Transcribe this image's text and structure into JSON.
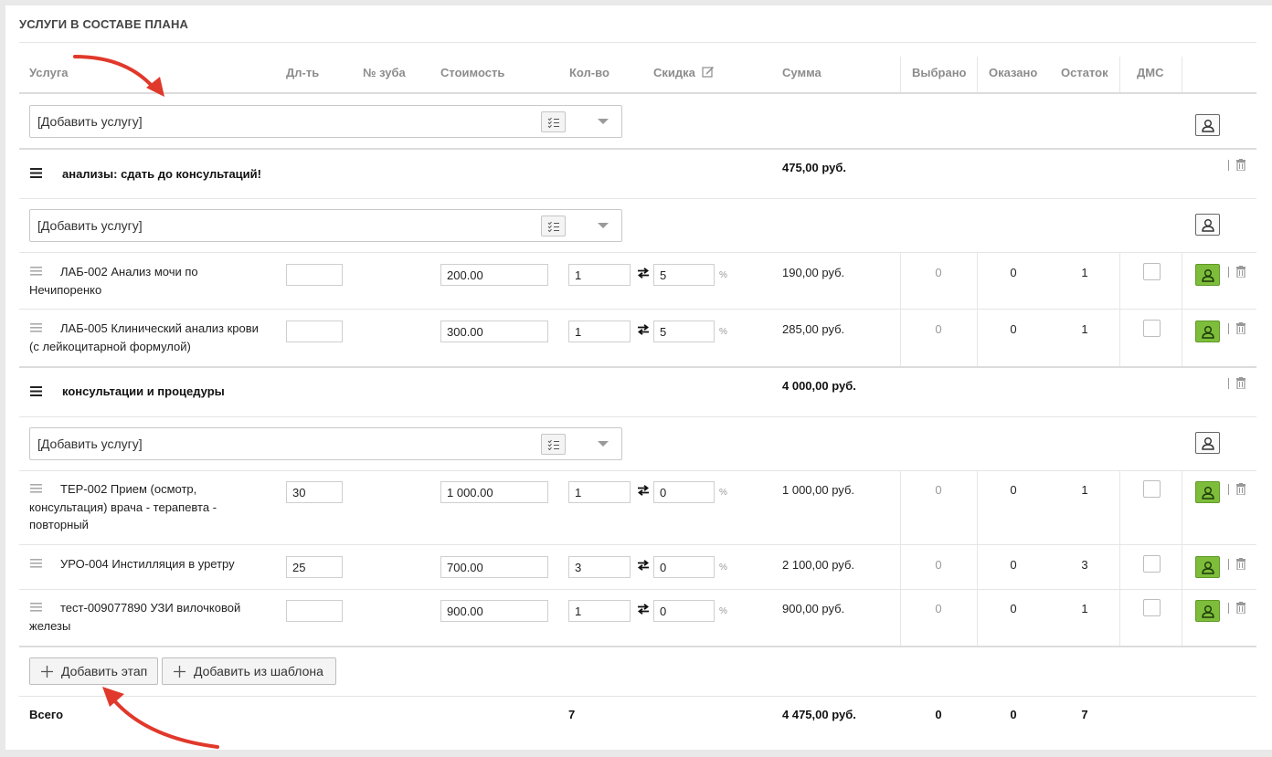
{
  "section": {
    "title": "УСЛУГИ В СОСТАВЕ ПЛАНА"
  },
  "columns": {
    "service": "Услуга",
    "duration": "Дл-ть",
    "tooth": "№ зуба",
    "price": "Стоимость",
    "qty": "Кол-во",
    "discount": "Скидка",
    "sum": "Сумма",
    "selected": "Выбрано",
    "done": "Оказано",
    "rest": "Остаток",
    "dms": "ДМС"
  },
  "add_service_placeholder": "[Добавить услугу]",
  "percent_sign": "%",
  "groups": [
    {
      "title": "анализы: сдать до консультаций!",
      "sum": "475,00 руб.",
      "items": [
        {
          "name": "ЛАБ-002 Анализ мочи по Нечипоренко",
          "duration": "",
          "price": "200.00",
          "qty": "1",
          "discount": "5",
          "sum": "190,00 руб.",
          "selected": "0",
          "done": "0",
          "rest": "1"
        },
        {
          "name": "ЛАБ-005 Клинический анализ крови (с лейкоцитарной формулой)",
          "duration": "",
          "price": "300.00",
          "qty": "1",
          "discount": "5",
          "sum": "285,00 руб.",
          "selected": "0",
          "done": "0",
          "rest": "1"
        }
      ]
    },
    {
      "title": "консультации и процедуры",
      "sum": "4 000,00 руб.",
      "items": [
        {
          "name": "ТЕР-002 Прием (осмотр, консультация) врача - терапевта - повторный",
          "duration": "30",
          "price": "1 000.00",
          "qty": "1",
          "discount": "0",
          "sum": "1 000,00 руб.",
          "selected": "0",
          "done": "0",
          "rest": "1"
        },
        {
          "name": "УРО-004 Инстилляция в уретру",
          "duration": "25",
          "price": "700.00",
          "qty": "3",
          "discount": "0",
          "sum": "2 100,00 руб.",
          "selected": "0",
          "done": "0",
          "rest": "3"
        },
        {
          "name": "тест-009077890 УЗИ вилочковой железы",
          "duration": "",
          "price": "900.00",
          "qty": "1",
          "discount": "0",
          "sum": "900,00 руб.",
          "selected": "0",
          "done": "0",
          "rest": "1"
        }
      ]
    }
  ],
  "buttons": {
    "add_stage": "Добавить этап",
    "add_from_template": "Добавить из шаблона"
  },
  "totals": {
    "label": "Всего",
    "qty": "7",
    "sum": "4 475,00 руб.",
    "selected": "0",
    "done": "0",
    "rest": "7"
  },
  "colors": {
    "accent_green": "#7dbd3b",
    "arrow_red": "#e0392b"
  }
}
